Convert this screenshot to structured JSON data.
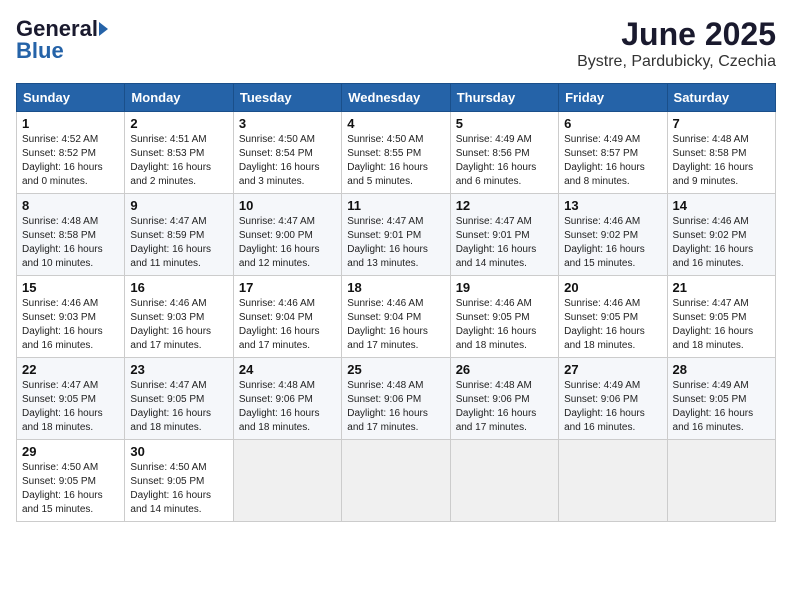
{
  "header": {
    "logo_general": "General",
    "logo_blue": "Blue",
    "month_title": "June 2025",
    "location": "Bystre, Pardubicky, Czechia"
  },
  "weekdays": [
    "Sunday",
    "Monday",
    "Tuesday",
    "Wednesday",
    "Thursday",
    "Friday",
    "Saturday"
  ],
  "weeks": [
    [
      {
        "day": "1",
        "info": "Sunrise: 4:52 AM\nSunset: 8:52 PM\nDaylight: 16 hours\nand 0 minutes."
      },
      {
        "day": "2",
        "info": "Sunrise: 4:51 AM\nSunset: 8:53 PM\nDaylight: 16 hours\nand 2 minutes."
      },
      {
        "day": "3",
        "info": "Sunrise: 4:50 AM\nSunset: 8:54 PM\nDaylight: 16 hours\nand 3 minutes."
      },
      {
        "day": "4",
        "info": "Sunrise: 4:50 AM\nSunset: 8:55 PM\nDaylight: 16 hours\nand 5 minutes."
      },
      {
        "day": "5",
        "info": "Sunrise: 4:49 AM\nSunset: 8:56 PM\nDaylight: 16 hours\nand 6 minutes."
      },
      {
        "day": "6",
        "info": "Sunrise: 4:49 AM\nSunset: 8:57 PM\nDaylight: 16 hours\nand 8 minutes."
      },
      {
        "day": "7",
        "info": "Sunrise: 4:48 AM\nSunset: 8:58 PM\nDaylight: 16 hours\nand 9 minutes."
      }
    ],
    [
      {
        "day": "8",
        "info": "Sunrise: 4:48 AM\nSunset: 8:58 PM\nDaylight: 16 hours\nand 10 minutes."
      },
      {
        "day": "9",
        "info": "Sunrise: 4:47 AM\nSunset: 8:59 PM\nDaylight: 16 hours\nand 11 minutes."
      },
      {
        "day": "10",
        "info": "Sunrise: 4:47 AM\nSunset: 9:00 PM\nDaylight: 16 hours\nand 12 minutes."
      },
      {
        "day": "11",
        "info": "Sunrise: 4:47 AM\nSunset: 9:01 PM\nDaylight: 16 hours\nand 13 minutes."
      },
      {
        "day": "12",
        "info": "Sunrise: 4:47 AM\nSunset: 9:01 PM\nDaylight: 16 hours\nand 14 minutes."
      },
      {
        "day": "13",
        "info": "Sunrise: 4:46 AM\nSunset: 9:02 PM\nDaylight: 16 hours\nand 15 minutes."
      },
      {
        "day": "14",
        "info": "Sunrise: 4:46 AM\nSunset: 9:02 PM\nDaylight: 16 hours\nand 16 minutes."
      }
    ],
    [
      {
        "day": "15",
        "info": "Sunrise: 4:46 AM\nSunset: 9:03 PM\nDaylight: 16 hours\nand 16 minutes."
      },
      {
        "day": "16",
        "info": "Sunrise: 4:46 AM\nSunset: 9:03 PM\nDaylight: 16 hours\nand 17 minutes."
      },
      {
        "day": "17",
        "info": "Sunrise: 4:46 AM\nSunset: 9:04 PM\nDaylight: 16 hours\nand 17 minutes."
      },
      {
        "day": "18",
        "info": "Sunrise: 4:46 AM\nSunset: 9:04 PM\nDaylight: 16 hours\nand 17 minutes."
      },
      {
        "day": "19",
        "info": "Sunrise: 4:46 AM\nSunset: 9:05 PM\nDaylight: 16 hours\nand 18 minutes."
      },
      {
        "day": "20",
        "info": "Sunrise: 4:46 AM\nSunset: 9:05 PM\nDaylight: 16 hours\nand 18 minutes."
      },
      {
        "day": "21",
        "info": "Sunrise: 4:47 AM\nSunset: 9:05 PM\nDaylight: 16 hours\nand 18 minutes."
      }
    ],
    [
      {
        "day": "22",
        "info": "Sunrise: 4:47 AM\nSunset: 9:05 PM\nDaylight: 16 hours\nand 18 minutes."
      },
      {
        "day": "23",
        "info": "Sunrise: 4:47 AM\nSunset: 9:05 PM\nDaylight: 16 hours\nand 18 minutes."
      },
      {
        "day": "24",
        "info": "Sunrise: 4:48 AM\nSunset: 9:06 PM\nDaylight: 16 hours\nand 18 minutes."
      },
      {
        "day": "25",
        "info": "Sunrise: 4:48 AM\nSunset: 9:06 PM\nDaylight: 16 hours\nand 17 minutes."
      },
      {
        "day": "26",
        "info": "Sunrise: 4:48 AM\nSunset: 9:06 PM\nDaylight: 16 hours\nand 17 minutes."
      },
      {
        "day": "27",
        "info": "Sunrise: 4:49 AM\nSunset: 9:06 PM\nDaylight: 16 hours\nand 16 minutes."
      },
      {
        "day": "28",
        "info": "Sunrise: 4:49 AM\nSunset: 9:05 PM\nDaylight: 16 hours\nand 16 minutes."
      }
    ],
    [
      {
        "day": "29",
        "info": "Sunrise: 4:50 AM\nSunset: 9:05 PM\nDaylight: 16 hours\nand 15 minutes."
      },
      {
        "day": "30",
        "info": "Sunrise: 4:50 AM\nSunset: 9:05 PM\nDaylight: 16 hours\nand 14 minutes."
      },
      {
        "day": "",
        "info": ""
      },
      {
        "day": "",
        "info": ""
      },
      {
        "day": "",
        "info": ""
      },
      {
        "day": "",
        "info": ""
      },
      {
        "day": "",
        "info": ""
      }
    ]
  ]
}
